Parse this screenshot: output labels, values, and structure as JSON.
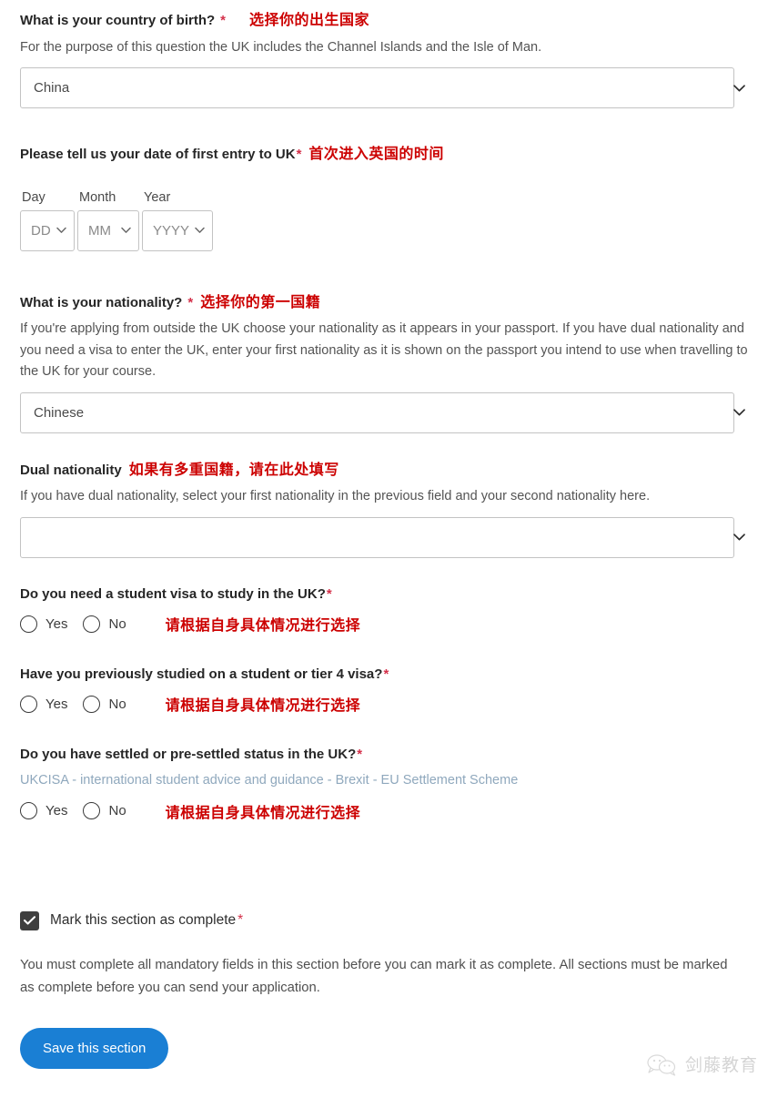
{
  "form": {
    "country_of_birth": {
      "label": "What is your country of birth?",
      "required_mark": "*",
      "annotation_cn": "选择你的出生国家",
      "hint": "For the purpose of this question the UK includes the Channel Islands and the Isle of Man.",
      "value": "China"
    },
    "first_entry_date": {
      "label": "Please tell us your date of first entry to UK",
      "required_mark": "*",
      "annotation_cn": "首次进入英国的时间",
      "day_caption": "Day",
      "month_caption": "Month",
      "year_caption": "Year",
      "day_value": "DD",
      "month_value": "MM",
      "year_value": "YYYY"
    },
    "nationality": {
      "label": "What is your nationality?",
      "required_mark": "*",
      "annotation_cn": "选择你的第一国籍",
      "hint": "If you're applying from outside the UK choose your nationality as it appears in your passport. If you have dual nationality and you need a visa to enter the UK, enter your first nationality as it is shown on the passport you intend to use when travelling to the UK for your course.",
      "value": "Chinese"
    },
    "dual_nationality": {
      "label": "Dual nationality",
      "annotation_cn": "如果有多重国籍，请在此处填写",
      "hint": "If you have dual nationality, select your first nationality in the previous field and your second nationality here.",
      "value": ""
    },
    "student_visa": {
      "label": "Do you need a student visa to study in the UK?",
      "required_mark": "*",
      "annotation_cn": "请根据自身具体情况进行选择",
      "option_yes": "Yes",
      "option_no": "No"
    },
    "previous_visa": {
      "label": "Have you previously studied on a student or tier 4 visa?",
      "required_mark": "*",
      "annotation_cn": "请根据自身具体情况进行选择",
      "option_yes": "Yes",
      "option_no": "No"
    },
    "settled_status": {
      "label": "Do you have settled or pre-settled status in the UK?",
      "required_mark": "*",
      "link_text": "UKCISA - international student advice and guidance - Brexit - EU Settlement Scheme",
      "annotation_cn": "请根据自身具体情况进行选择",
      "option_yes": "Yes",
      "option_no": "No"
    }
  },
  "completion": {
    "checkbox_label": "Mark this section as complete",
    "required_mark": "*",
    "checked": true,
    "note": "You must complete all mandatory fields in this section before you can mark it as complete. All sections must be marked as complete before you can send your application."
  },
  "actions": {
    "save_label": "Save this section"
  },
  "watermark": {
    "text": "剑藤教育"
  },
  "colors": {
    "required_asterisk": "#d4304a",
    "annotation_red": "#cc0000",
    "link_blue": "#8fa8bd",
    "button_blue": "#1a7fd4",
    "checkbox_fill": "#3f3f3f"
  }
}
